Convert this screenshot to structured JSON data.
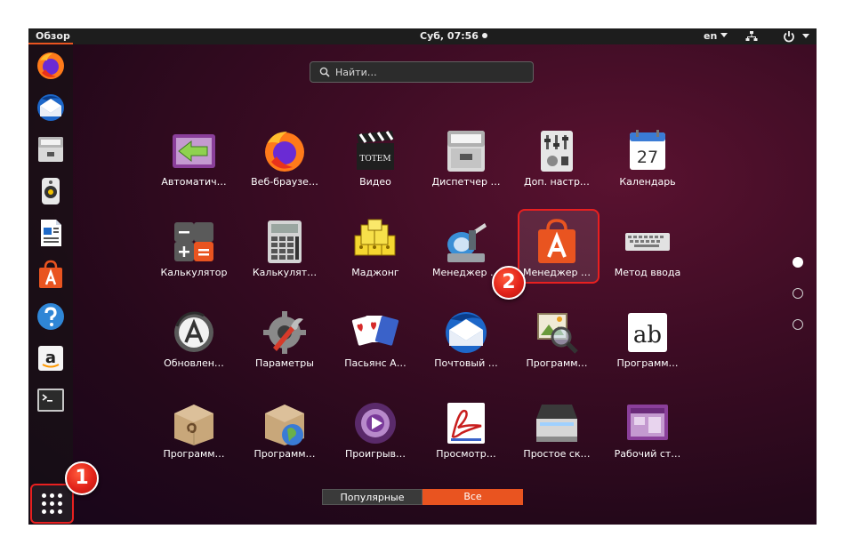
{
  "topbar": {
    "activities": "Обзор",
    "clock": "Суб, 07:56",
    "language": "en"
  },
  "dock": {
    "items": [
      {
        "name": "firefox"
      },
      {
        "name": "thunderbird"
      },
      {
        "name": "files"
      },
      {
        "name": "rhythmbox"
      },
      {
        "name": "libreoffice-writer"
      },
      {
        "name": "software"
      },
      {
        "name": "help"
      },
      {
        "name": "amazon"
      },
      {
        "name": "terminal"
      }
    ]
  },
  "search": {
    "placeholder": "Найти…"
  },
  "apps": [
    {
      "label": "Автоматич…",
      "icon": "startup-icon"
    },
    {
      "label": "Веб-браузе…",
      "icon": "firefox-icon"
    },
    {
      "label": "Видео",
      "icon": "video-icon"
    },
    {
      "label": "Диспетчер …",
      "icon": "archive-icon"
    },
    {
      "label": "Доп. настр…",
      "icon": "tweaks-icon"
    },
    {
      "label": "Календарь",
      "icon": "calendar-icon"
    },
    {
      "label": "Калькулятор",
      "icon": "calculator-icon"
    },
    {
      "label": "Калькулят…",
      "icon": "calculator-classic-icon"
    },
    {
      "label": "Маджонг",
      "icon": "mahjongg-icon"
    },
    {
      "label": "Менеджер …",
      "icon": "disk-manager-icon"
    },
    {
      "label": "Менеджер …",
      "icon": "software-icon"
    },
    {
      "label": "Метод ввода",
      "icon": "keyboard-icon"
    },
    {
      "label": "Обновлен…",
      "icon": "update-icon"
    },
    {
      "label": "Параметры",
      "icon": "settings-icon"
    },
    {
      "label": "Пасьянс А…",
      "icon": "cards-icon"
    },
    {
      "label": "Почтовый …",
      "icon": "mail-icon"
    },
    {
      "label": "Программ…",
      "icon": "image-viewer-icon"
    },
    {
      "label": "Программ…",
      "icon": "font-viewer-icon"
    },
    {
      "label": "Программ…",
      "icon": "deb-package-icon"
    },
    {
      "label": "Программ…",
      "icon": "package-globe-icon"
    },
    {
      "label": "Проигрыв…",
      "icon": "player-icon"
    },
    {
      "label": "Просмотр…",
      "icon": "pdf-viewer-icon"
    },
    {
      "label": "Простое ск…",
      "icon": "scanner-icon"
    },
    {
      "label": "Рабочий ст…",
      "icon": "desktop-icon"
    }
  ],
  "calendar": {
    "day": "27"
  },
  "font_viewer": {
    "glyphs": "ab"
  },
  "badges": {
    "one": "1",
    "two": "2"
  },
  "switcher": {
    "frequent": "Популярные",
    "all": "Все"
  },
  "colors": {
    "accent": "#e95420",
    "highlight": "#e82020"
  }
}
